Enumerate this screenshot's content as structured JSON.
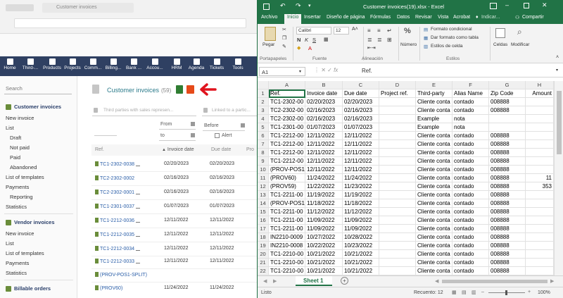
{
  "browser": {
    "tab_title": "Customer invoices"
  },
  "topnav": [
    {
      "label": "Home"
    },
    {
      "label": "Third-..."
    },
    {
      "label": "Products"
    },
    {
      "label": "Projects"
    },
    {
      "label": "Comm..."
    },
    {
      "label": "Billing..."
    },
    {
      "label": "Bank ..."
    },
    {
      "label": "Accou..."
    },
    {
      "label": "HRM"
    },
    {
      "label": "Agenda"
    },
    {
      "label": "Tickets"
    },
    {
      "label": "Tools"
    }
  ],
  "leftmenu": {
    "search_placeholder": "Search",
    "customer_invoices": "Customer invoices",
    "new_invoice": "New invoice",
    "list": "List",
    "draft": "Draft",
    "not_paid": "Not paid",
    "paid": "Paid",
    "abandoned": "Abandoned",
    "list_templates": "List of templates",
    "payments": "Payments",
    "reporting": "Reporting",
    "statistics": "Statistics",
    "vendor_invoices": "Vendor invoices",
    "v_new_invoice": "New invoice",
    "v_list": "List",
    "v_list_templates": "List of templates",
    "v_payments": "Payments",
    "v_statistics": "Statistics",
    "billable_orders": "Billable orders"
  },
  "main": {
    "title": "Customer invoices",
    "count": "(59)",
    "filter_sales_placeholder": "Third parties with sales represen...",
    "filter_linked_placeholder": "Linked to a partic...",
    "from_label": "From",
    "to_label": "to",
    "before_label": "Before",
    "alert_label": "Alert",
    "col_ref": "Ref.",
    "col_invoice_date": "Invoice date",
    "col_due_date": "Due date",
    "col_pro": "Pro",
    "rows": [
      {
        "ref": "TC1-2302-0038",
        "invoice_date": "02/20/2023",
        "due_date": "02/20/2023"
      },
      {
        "ref": "TC2-2302-0002",
        "invoice_date": "02/16/2023",
        "due_date": "02/16/2023"
      },
      {
        "ref": "TC2-2302-0001",
        "invoice_date": "02/16/2023",
        "due_date": "02/16/2023"
      },
      {
        "ref": "TC1-2301-0037",
        "invoice_date": "01/07/2023",
        "due_date": "01/07/2023"
      },
      {
        "ref": "TC1-2212-0036",
        "invoice_date": "12/11/2022",
        "due_date": "12/11/2022"
      },
      {
        "ref": "TC1-2212-0035",
        "invoice_date": "12/11/2022",
        "due_date": "12/11/2022"
      },
      {
        "ref": "TC1-2212-0034",
        "invoice_date": "12/11/2022",
        "due_date": "12/11/2022"
      },
      {
        "ref": "TC1-2212-0033",
        "invoice_date": "12/11/2022",
        "due_date": "12/11/2022"
      },
      {
        "ref": "(PROV-POS1-SPLIT)",
        "invoice_date": "",
        "due_date": ""
      },
      {
        "ref": "(PROV60)",
        "invoice_date": "11/24/2022",
        "due_date": "11/24/2022"
      }
    ]
  },
  "excel": {
    "title": "Customer invoices(19).xlsx - Excel",
    "tabs": [
      "Archivo",
      "Inicio",
      "Insertar",
      "Diseño de página",
      "Fórmulas",
      "Datos",
      "Revisar",
      "Vista",
      "Acrobat"
    ],
    "tell_me": "Indicar...",
    "share": "Compartir",
    "ribbon": {
      "paste": "Pegar",
      "font_name": "Calibri",
      "font_size": "12",
      "number": "Número",
      "conditional": "Formato condicional",
      "format_table": "Dar formato como tabla",
      "cell_styles": "Estilos de celda",
      "cells": "Celdas",
      "modify": "Modificar",
      "grp_clipboard": "Portapapeles",
      "grp_font": "Fuente",
      "grp_align": "Alineación",
      "grp_styles": "Estilos"
    },
    "name_box": "A1",
    "formula": "Ref.",
    "columns": [
      "A",
      "B",
      "C",
      "D",
      "E",
      "F",
      "G",
      "H"
    ],
    "rows": [
      [
        "Ref.",
        "Invoice date",
        "Due date",
        "Project ref.",
        "Third-party",
        "Alias Name",
        "Zip Code",
        "Amount"
      ],
      [
        "TC1-2302-00",
        "02/20/2023",
        "02/20/2023",
        "",
        "Cliente conta",
        "contado",
        "008888",
        ""
      ],
      [
        "TC2-2302-00",
        "02/16/2023",
        "02/16/2023",
        "",
        "Cliente conta",
        "contado",
        "008888",
        ""
      ],
      [
        "TC2-2302-00",
        "02/16/2023",
        "02/16/2023",
        "",
        "Example",
        "nota",
        "",
        ""
      ],
      [
        "TC1-2301-00",
        "01/07/2023",
        "01/07/2023",
        "",
        "Example",
        "nota",
        "",
        ""
      ],
      [
        "TC1-2212-00",
        "12/11/2022",
        "12/11/2022",
        "",
        "Cliente conta",
        "contado",
        "008888",
        ""
      ],
      [
        "TC1-2212-00",
        "12/11/2022",
        "12/11/2022",
        "",
        "Cliente conta",
        "contado",
        "008888",
        ""
      ],
      [
        "TC1-2212-00",
        "12/11/2022",
        "12/11/2022",
        "",
        "Cliente conta",
        "contado",
        "008888",
        ""
      ],
      [
        "TC1-2212-00",
        "12/11/2022",
        "12/11/2022",
        "",
        "Cliente conta",
        "contado",
        "008888",
        ""
      ],
      [
        "(PROV-POS1",
        "12/11/2022",
        "12/11/2022",
        "",
        "Cliente conta",
        "contado",
        "008888",
        ""
      ],
      [
        "(PROV60)",
        "11/24/2022",
        "11/24/2022",
        "",
        "Cliente conta",
        "contado",
        "008888",
        "11"
      ],
      [
        "(PROV59)",
        "11/22/2022",
        "11/23/2022",
        "",
        "Cliente conta",
        "contado",
        "008888",
        "353"
      ],
      [
        "TC1-2211-00",
        "11/19/2022",
        "11/19/2022",
        "",
        "Cliente conta",
        "contado",
        "008888",
        ""
      ],
      [
        "(PROV-POS1",
        "11/18/2022",
        "11/18/2022",
        "",
        "Cliente conta",
        "contado",
        "008888",
        ""
      ],
      [
        "TC1-2211-00",
        "11/12/2022",
        "11/12/2022",
        "",
        "Cliente conta",
        "contado",
        "008888",
        ""
      ],
      [
        "TC1-2211-00",
        "11/09/2022",
        "11/09/2022",
        "",
        "Cliente conta",
        "contado",
        "008888",
        ""
      ],
      [
        "TC1-2211-00",
        "11/09/2022",
        "11/09/2022",
        "",
        "Cliente conta",
        "contado",
        "008888",
        ""
      ],
      [
        "IN2210-0009",
        "10/27/2022",
        "10/28/2022",
        "",
        "Cliente conta",
        "contado",
        "008888",
        ""
      ],
      [
        "IN2210-0008",
        "10/22/2022",
        "10/23/2022",
        "",
        "Cliente conta",
        "contado",
        "008888",
        ""
      ],
      [
        "TC1-2210-00",
        "10/21/2022",
        "10/21/2022",
        "",
        "Cliente conta",
        "contado",
        "008888",
        ""
      ],
      [
        "TC1-2210-00",
        "10/21/2022",
        "10/21/2022",
        "",
        "Cliente conta",
        "contado",
        "008888",
        ""
      ],
      [
        "TC1-2210-00",
        "10/21/2022",
        "10/21/2022",
        "",
        "Cliente conta",
        "contado",
        "008888",
        ""
      ]
    ],
    "sheet_tab": "Sheet 1",
    "status_ready": "Listo",
    "status_count": "Recuento: 12",
    "zoom": "100%"
  }
}
